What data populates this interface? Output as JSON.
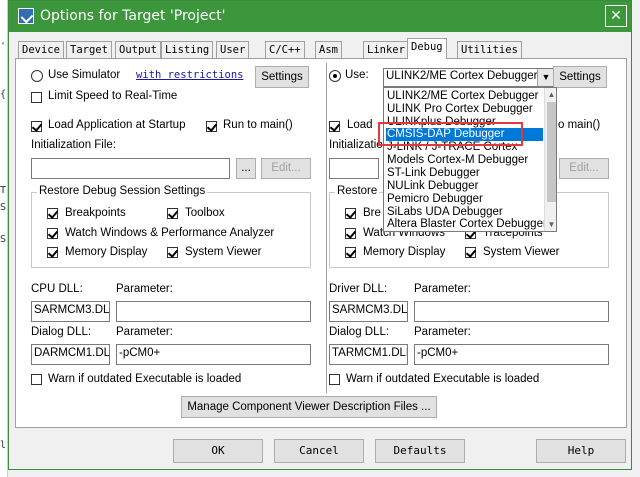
{
  "background_editor": {
    "chars": [
      "'",
      "{",
      "T",
      "S",
      "S",
      "l"
    ]
  },
  "window": {
    "title": "Options for Target 'Project'",
    "close_glyph": "✕"
  },
  "tabs": [
    "Device",
    "Target",
    "Output",
    "Listing",
    "User",
    "C/C++",
    "Asm",
    "Linker",
    "Debug",
    "Utilities"
  ],
  "active_tab": "Debug",
  "left": {
    "use_simulator_label": "Use Simulator",
    "restrictions_link": "with restrictions",
    "settings_label": "Settings",
    "limit_speed_label": "Limit Speed to Real-Time",
    "load_app_label": "Load Application at Startup",
    "run_main_label": "Run to main()",
    "init_file_label": "Initialization File:",
    "init_file_value": "",
    "browse_label": "...",
    "edit_label": "Edit...",
    "restore_title": "Restore Debug Session Settings",
    "breakpoints_label": "Breakpoints",
    "toolbox_label": "Toolbox",
    "watch_label": "Watch Windows & Performance Analyzer",
    "memory_label": "Memory Display",
    "system_viewer_label": "System Viewer",
    "cpu_dll_label": "CPU DLL:",
    "cpu_dll_value": "SARMCM3.DLL",
    "cpu_param_label": "Parameter:",
    "cpu_param_value": "",
    "dialog_dll_label": "Dialog DLL:",
    "dialog_dll_value": "DARMCM1.DLL",
    "dialog_param_label": "Parameter:",
    "dialog_param_value": "-pCM0+",
    "warn_label": "Warn if outdated Executable is loaded"
  },
  "right": {
    "use_label": "Use:",
    "debugger_selected": "ULINK2/ME Cortex Debugger",
    "settings_label": "Settings",
    "load_partial": "Load",
    "run_main_partial": "o main()",
    "init_partial": "Initialization",
    "edit_label": "Edit...",
    "restore_partial": "Restore",
    "breakpoints_partial": "Bre",
    "tracepoints_label": "Tracepoints",
    "watch_label": "Watch Windows",
    "memory_label": "Memory Display",
    "system_viewer_label": "System Viewer",
    "driver_dll_label": "Driver DLL:",
    "driver_dll_value": "SARMCM3.DLL",
    "driver_param_label": "Parameter:",
    "driver_param_value": "",
    "dialog_dll_label": "Dialog DLL:",
    "dialog_dll_value": "TARMCM1.DLL",
    "dialog_param_label": "Parameter:",
    "dialog_param_value": "-pCM0+",
    "warn_label": "Warn if outdated Executable is loaded"
  },
  "dropdown": {
    "items": [
      "ULINK2/ME Cortex Debugger",
      "ULINK Pro Cortex Debugger",
      "ULINKplus Debugger",
      "CMSIS-DAP Debugger",
      "J-LINK / J-TRACE Cortex",
      "Models Cortex-M Debugger",
      "ST-Link Debugger",
      "NULink Debugger",
      "Pemicro Debugger",
      "SiLabs UDA Debugger",
      "Altera Blaster Cortex Debugger"
    ],
    "selected": "CMSIS-DAP Debugger",
    "highlight_color": "#e03a3a",
    "selection_color": "#0078d7"
  },
  "manage_button": "Manage Component Viewer Description Files ...",
  "footer": {
    "ok": "OK",
    "cancel": "Cancel",
    "defaults": "Defaults",
    "help": "Help"
  },
  "colors": {
    "titlebar": "#3c963c"
  }
}
